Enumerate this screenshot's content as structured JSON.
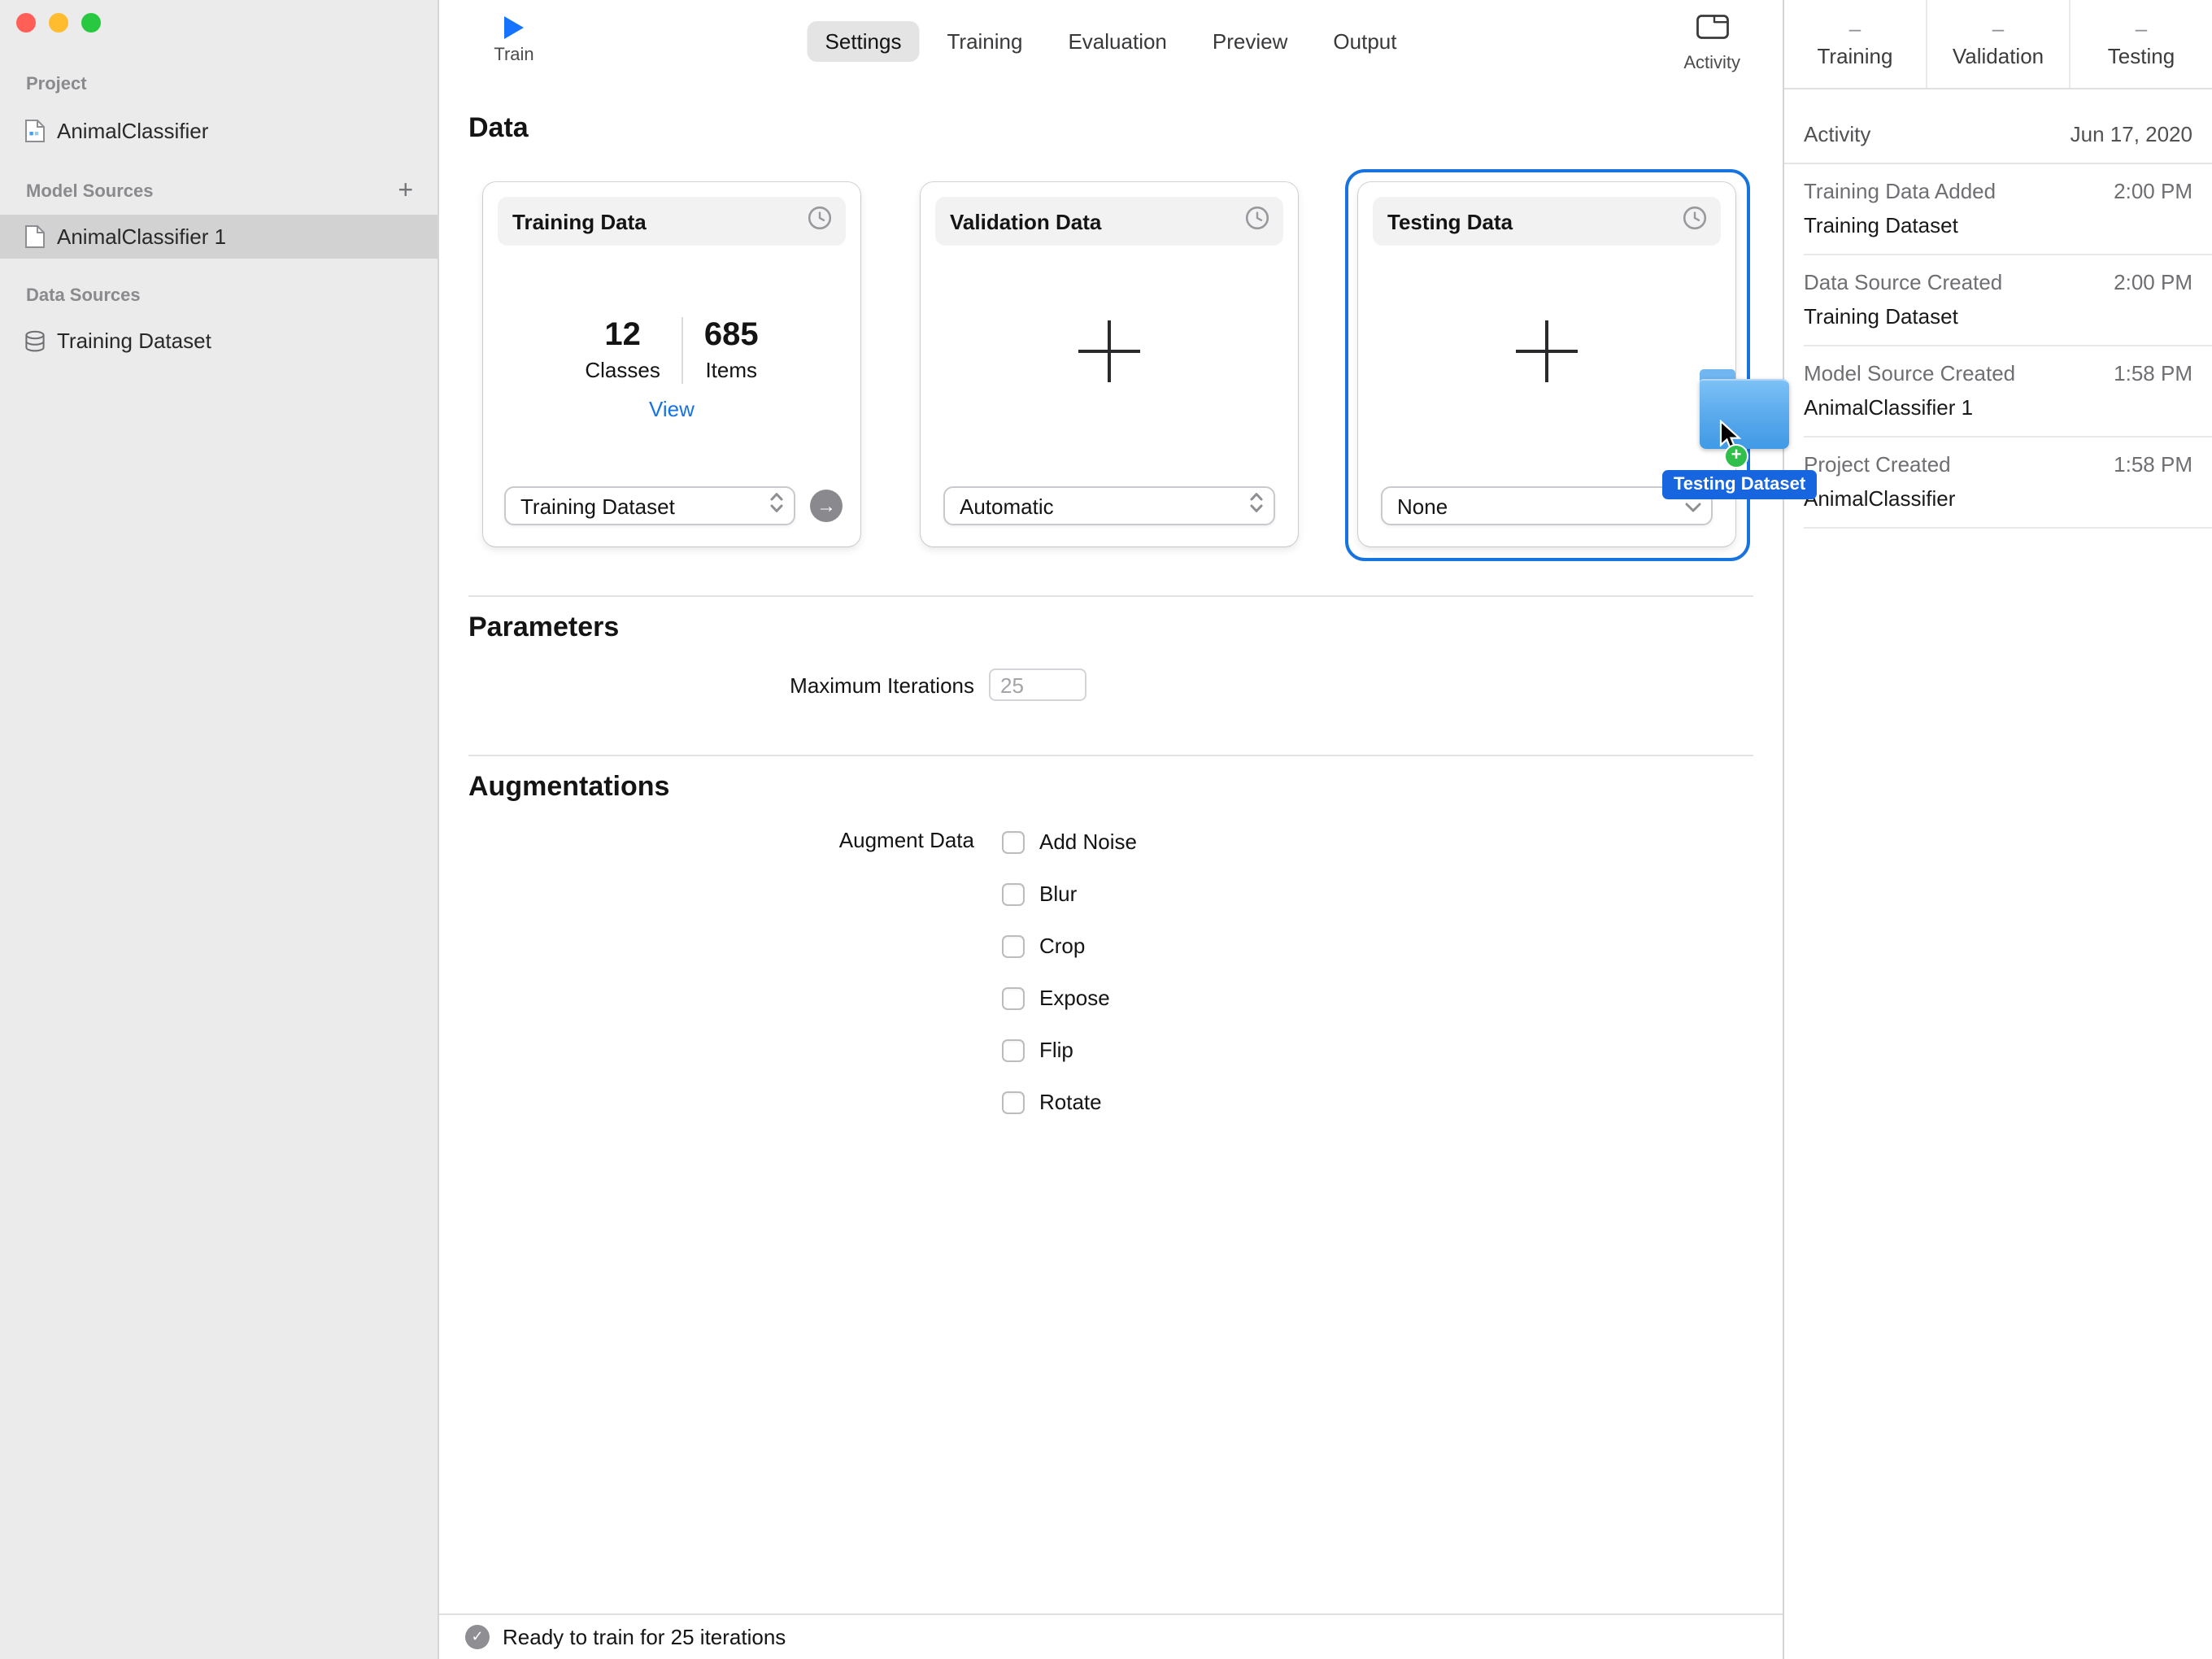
{
  "colors": {
    "accent_blue": "#1673e0",
    "link_blue": "#1673e6",
    "folder_blue": "#58a8ec",
    "badge_green": "#2fbf4a",
    "sidebar_gray": "#ebebeb",
    "selection_gray": "#d2d2d2"
  },
  "icons": {
    "go_arrow": "→",
    "check": "✓",
    "badge_plus": "+"
  },
  "sidebar": {
    "sections": [
      {
        "label": "Project"
      },
      {
        "label": "Model Sources"
      },
      {
        "label": "Data Sources"
      }
    ],
    "add_button": "+",
    "project_item": "AnimalClassifier",
    "model_item": "AnimalClassifier 1",
    "data_item": "Training Dataset"
  },
  "toolbar": {
    "train_label": "Train",
    "tabs": [
      "Settings",
      "Training",
      "Evaluation",
      "Preview",
      "Output"
    ],
    "activity_label": "Activity"
  },
  "main": {
    "data_title": "Data",
    "cards": {
      "training": {
        "title": "Training Data",
        "classes_value": "12",
        "classes_label": "Classes",
        "items_value": "685",
        "items_label": "Items",
        "view_link": "View",
        "dropdown_value": "Training Dataset"
      },
      "validation": {
        "title": "Validation Data",
        "dropdown_value": "Automatic"
      },
      "testing": {
        "title": "Testing Data",
        "dropdown_value": "None"
      }
    },
    "parameters_title": "Parameters",
    "max_iterations_label": "Maximum Iterations",
    "max_iterations_value": "25",
    "augmentations_title": "Augmentations",
    "augment_data_label": "Augment Data",
    "augment_options": [
      "Add Noise",
      "Blur",
      "Crop",
      "Expose",
      "Flip",
      "Rotate"
    ],
    "status_text": "Ready to train for 25 iterations"
  },
  "drag": {
    "tooltip": "Testing Dataset"
  },
  "right_panel": {
    "metrics": [
      {
        "value": "–",
        "label": "Training"
      },
      {
        "value": "–",
        "label": "Validation"
      },
      {
        "value": "–",
        "label": "Testing"
      }
    ],
    "activity_title": "Activity",
    "activity_date": "Jun 17, 2020",
    "entries": [
      {
        "title": "Training Data Added",
        "time": "2:00 PM",
        "subtitle": "Training Dataset"
      },
      {
        "title": "Data Source Created",
        "time": "2:00 PM",
        "subtitle": "Training Dataset"
      },
      {
        "title": "Model Source Created",
        "time": "1:58 PM",
        "subtitle": "AnimalClassifier 1"
      },
      {
        "title": "Project Created",
        "time": "1:58 PM",
        "subtitle": "AnimalClassifier"
      }
    ]
  }
}
